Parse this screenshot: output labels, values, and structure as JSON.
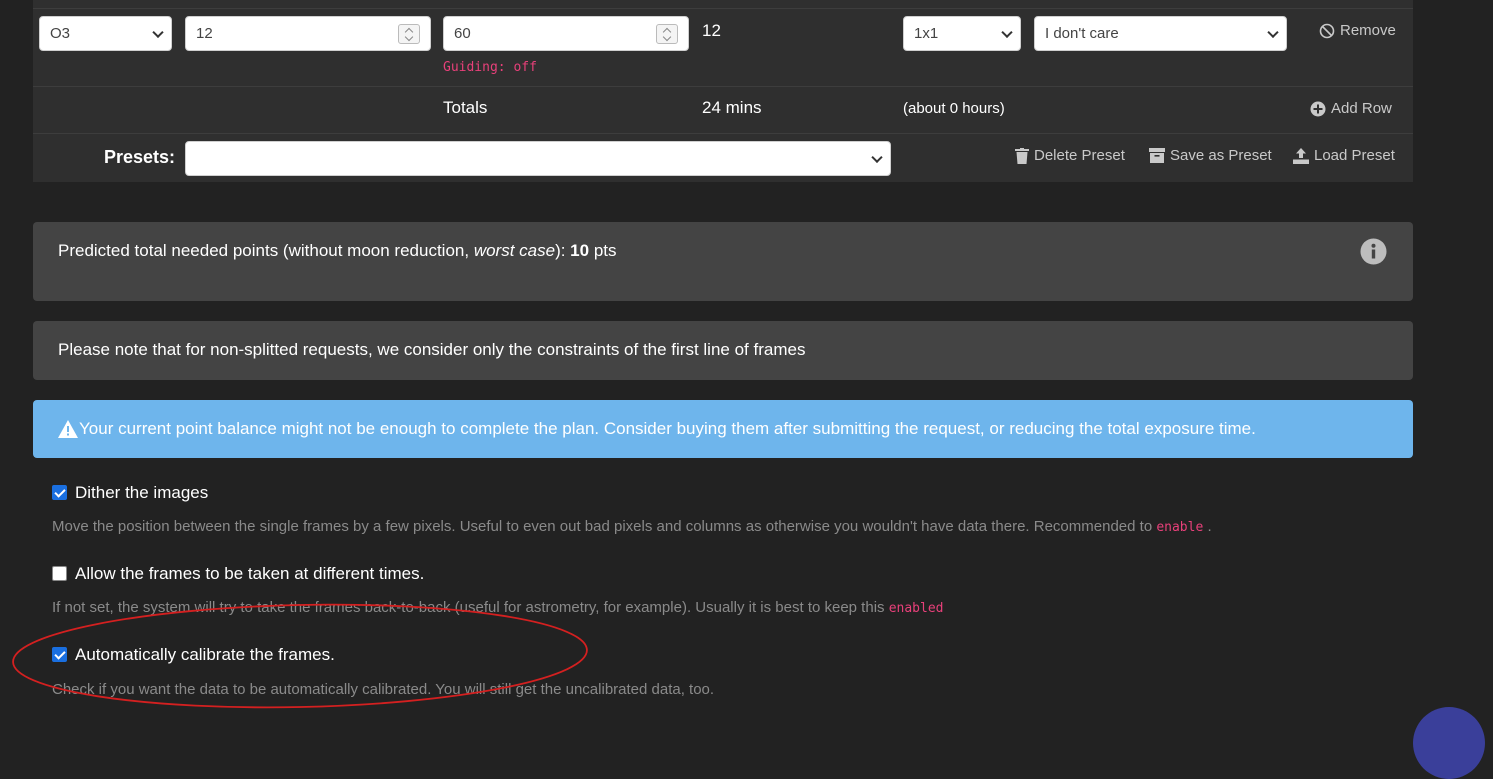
{
  "frame_row": {
    "filter": "O3",
    "count": "12",
    "exposure": "60",
    "total_count": "12",
    "binning": "1x1",
    "option": "I don't care",
    "guiding_label": "Guiding:",
    "guiding_value": "off",
    "remove_label": "Remove"
  },
  "totals": {
    "label": "Totals",
    "duration": "24 mins",
    "hours": "(about 0 hours)",
    "add_row_label": "Add Row"
  },
  "presets": {
    "label": "Presets:",
    "selected": "",
    "delete_label": "Delete Preset",
    "save_label": "Save as Preset",
    "load_label": "Load Preset"
  },
  "prediction": {
    "text_before": "Predicted total needed points (without moon reduction, ",
    "text_italic": "worst case",
    "text_after": "): ",
    "points": "10",
    "unit": " pts"
  },
  "note": {
    "text": "Please note that for non-splitted requests, we consider only the constraints of the first line of frames"
  },
  "alert": {
    "text": "Your current point balance might not be enough to complete the plan. Consider buying them after submitting the request, or reducing the total exposure time."
  },
  "options": {
    "dither": {
      "label": "Dither the images",
      "help": "Move the position between the single frames by a few pixels. Useful to even out bad pixels and columns as otherwise you wouldn't have data there. Recommended to ",
      "help_code": "enable",
      "help_tail": " .",
      "checked": true
    },
    "different_times": {
      "label": "Allow the frames to be taken at different times.",
      "help": "If not set, the system will try to take the frames back-to-back (useful for astrometry, for example). Usually it is best to keep this ",
      "help_code": "enabled",
      "checked": false
    },
    "calibrate": {
      "label": "Automatically calibrate the frames.",
      "help": "Check if you want the data to be automatically calibrated. You will still get the uncalibrated data, too.",
      "checked": true
    }
  },
  "colors": {
    "annotation": "#d42020",
    "alert": "#6eb5ec",
    "checkbox": "#1a6fe0",
    "code": "#e8407a"
  }
}
